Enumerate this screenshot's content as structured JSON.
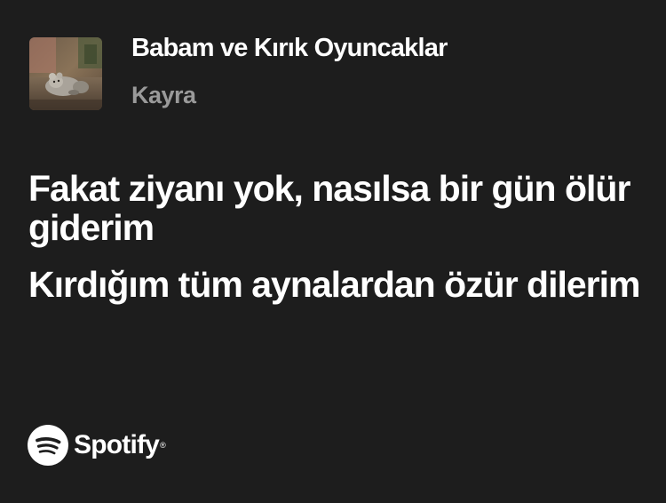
{
  "track": {
    "title": "Babam ve Kırık Oyuncaklar",
    "artist": "Kayra"
  },
  "lyrics": [
    "Fakat ziyanı yok, nasılsa bir gün ölür giderim",
    "Kırdığım tüm aynalardan özür dilerim"
  ],
  "brand": {
    "name": "Spotify",
    "icon": "spotify-logo-icon"
  },
  "colors": {
    "background": "#1d1d1d",
    "title": "#ffffff",
    "artist": "#9a9a9a"
  }
}
